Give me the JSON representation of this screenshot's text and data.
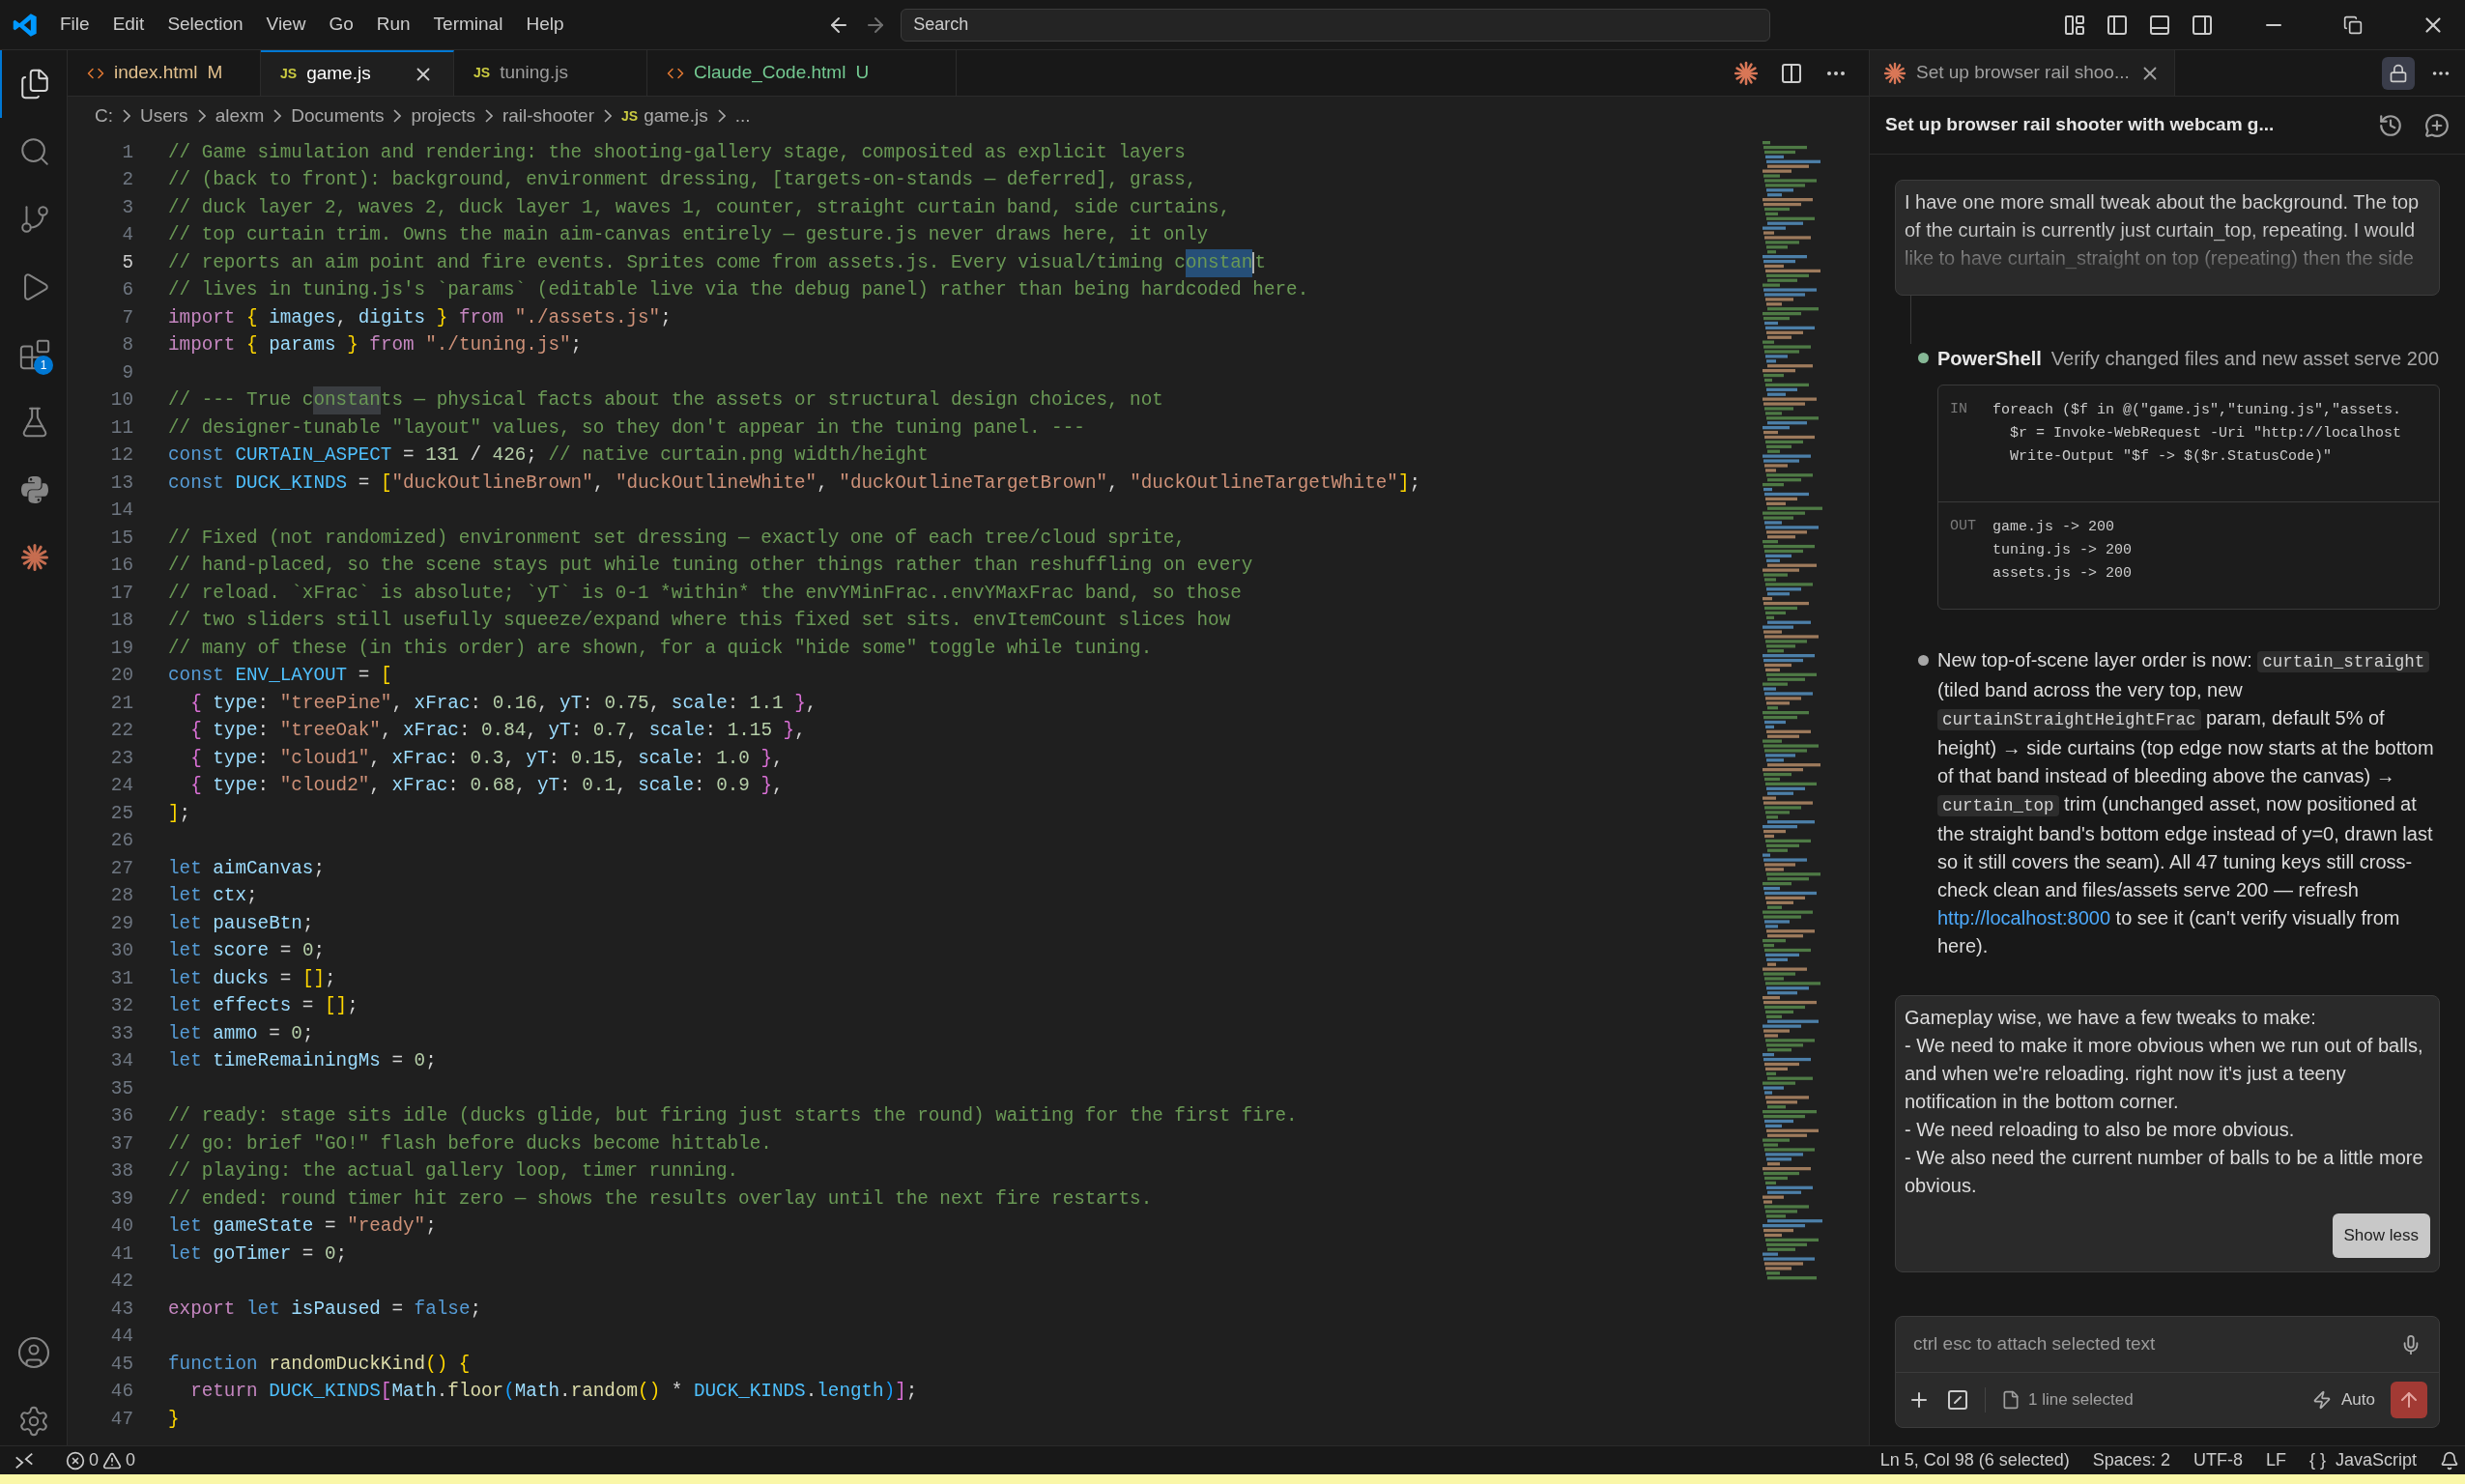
{
  "menu": [
    "File",
    "Edit",
    "Selection",
    "View",
    "Go",
    "Run",
    "Terminal",
    "Help"
  ],
  "search": {
    "placeholder": "Search"
  },
  "activity_bar": [
    {
      "kind": "files",
      "selected": true
    },
    {
      "kind": "search",
      "selected": false
    },
    {
      "kind": "branch",
      "selected": false
    },
    {
      "kind": "run",
      "selected": false
    },
    {
      "kind": "extensions",
      "selected": false,
      "badge": "1"
    },
    {
      "kind": "flask",
      "selected": false
    },
    {
      "kind": "python",
      "selected": false
    },
    {
      "kind": "starburst",
      "selected": false
    }
  ],
  "tabs": [
    {
      "label": "index.html",
      "kind": "html",
      "status": "M",
      "color": "#e2c08d",
      "selected": false
    },
    {
      "label": "game.js",
      "kind": "js",
      "badge": "JS",
      "selected": true
    },
    {
      "label": "tuning.js",
      "kind": "js",
      "badge": "JS",
      "selected": false
    },
    {
      "label": "Claude_Code.html",
      "kind": "html",
      "status": "U",
      "color": "#73c991",
      "selected": false
    }
  ],
  "breadcrumb": [
    {
      "label": "C:"
    },
    {
      "label": "Users"
    },
    {
      "label": "alexm"
    },
    {
      "label": "Documents"
    },
    {
      "label": "projects"
    },
    {
      "label": "rail-shooter"
    },
    {
      "label": "game.js",
      "badge": "JS"
    },
    {
      "label": "..."
    }
  ],
  "code_lines": [
    {
      "n": "1",
      "current": false,
      "tokens": [
        {
          "text": "// Game simulation and rendering: the shooting-gallery stage, composited as explicit layers",
          "kind": "comment"
        }
      ]
    },
    {
      "n": "2",
      "current": false,
      "tokens": [
        {
          "text": "// (back to front): background, environment dressing, [targets-on-stands — deferred], grass,",
          "kind": "comment"
        }
      ]
    },
    {
      "n": "3",
      "current": false,
      "tokens": [
        {
          "text": "// duck layer 2, waves 2, duck layer 1, waves 1, counter, straight curtain band, side curtains,",
          "kind": "comment"
        }
      ]
    },
    {
      "n": "4",
      "current": false,
      "tokens": [
        {
          "text": "// top curtain trim. Owns the main aim-canvas entirely — gesture.js never draws here, it only",
          "kind": "comment"
        }
      ]
    },
    {
      "n": "5",
      "current": true,
      "tokens": [
        {
          "text": "// reports an aim point and fire events. Sprites come from assets.js. Every visual/timing c",
          "kind": "comment"
        },
        {
          "text": "onstan",
          "kind": "selection"
        },
        {
          "text": "t",
          "kind": "comment"
        }
      ]
    },
    {
      "n": "6",
      "current": false,
      "tokens": [
        {
          "text": "// lives in tuning.js's `params` (editable live via the debug panel) rather than being hardcoded here.",
          "kind": "comment"
        }
      ]
    },
    {
      "n": "7",
      "current": false,
      "tokens": [
        {
          "text": "import ",
          "kind": "keyword"
        },
        {
          "text": "{",
          "kind": "bracket1"
        },
        {
          "text": " images",
          "kind": "variable"
        },
        {
          "text": ", ",
          "kind": "punct"
        },
        {
          "text": "digits ",
          "kind": "variable"
        },
        {
          "text": "}",
          "kind": "bracket1"
        },
        {
          "text": " from ",
          "kind": "keyword"
        },
        {
          "text": "\"./assets.js\"",
          "kind": "string"
        },
        {
          "text": ";",
          "kind": "punct"
        }
      ]
    },
    {
      "n": "8",
      "current": false,
      "tokens": [
        {
          "text": "import ",
          "kind": "keyword"
        },
        {
          "text": "{",
          "kind": "bracket1"
        },
        {
          "text": " params ",
          "kind": "variable"
        },
        {
          "text": "}",
          "kind": "bracket1"
        },
        {
          "text": " from ",
          "kind": "keyword"
        },
        {
          "text": "\"./tuning.js\"",
          "kind": "string"
        },
        {
          "text": ";",
          "kind": "punct"
        }
      ]
    },
    {
      "n": "9",
      "current": false
    },
    {
      "n": "10",
      "current": false,
      "tokens": [
        {
          "text": "// --- True c",
          "kind": "comment"
        },
        {
          "text": "onstan",
          "kind": "occurrence"
        },
        {
          "text": "ts — physical facts about the assets or structural design choices, not",
          "kind": "comment"
        }
      ]
    },
    {
      "n": "11",
      "current": false,
      "tokens": [
        {
          "text": "// designer-tunable \"layout\" values, so they don't appear in the tuning panel. ---",
          "kind": "comment"
        }
      ]
    },
    {
      "n": "12",
      "current": false,
      "tokens": [
        {
          "text": "const ",
          "kind": "storage"
        },
        {
          "text": "CURTAIN_ASPECT",
          "kind": "constant"
        },
        {
          "text": " = ",
          "kind": "punct"
        },
        {
          "text": "131",
          "kind": "number"
        },
        {
          "text": " / ",
          "kind": "punct"
        },
        {
          "text": "426",
          "kind": "number"
        },
        {
          "text": "; ",
          "kind": "punct"
        },
        {
          "text": "// native curtain.png width/height",
          "kind": "comment"
        }
      ]
    },
    {
      "n": "13",
      "current": false,
      "tokens": [
        {
          "text": "const ",
          "kind": "storage"
        },
        {
          "text": "DUCK_KINDS",
          "kind": "constant"
        },
        {
          "text": " = ",
          "kind": "punct"
        },
        {
          "text": "[",
          "kind": "bracket1"
        },
        {
          "text": "\"duckOutlineBrown\"",
          "kind": "string"
        },
        {
          "text": ", ",
          "kind": "punct"
        },
        {
          "text": "\"duckOutlineWhite\"",
          "kind": "string"
        },
        {
          "text": ", ",
          "kind": "punct"
        },
        {
          "text": "\"duckOutlineTargetBrown\"",
          "kind": "string"
        },
        {
          "text": ", ",
          "kind": "punct"
        },
        {
          "text": "\"duckOutlineTargetWhite\"",
          "kind": "string"
        },
        {
          "text": "]",
          "kind": "bracket1"
        },
        {
          "text": ";",
          "kind": "punct"
        }
      ]
    },
    {
      "n": "14",
      "current": false
    },
    {
      "n": "15",
      "current": false,
      "tokens": [
        {
          "text": "// Fixed (not randomized) environment set dressing — exactly one of each tree/cloud sprite,",
          "kind": "comment"
        }
      ]
    },
    {
      "n": "16",
      "current": false,
      "tokens": [
        {
          "text": "// hand-placed, so the scene stays put while tuning other things rather than reshuffling on every",
          "kind": "comment"
        }
      ]
    },
    {
      "n": "17",
      "current": false,
      "tokens": [
        {
          "text": "// reload. `xFrac` is absolute; `yT` is 0-1 *within* the envYMinFrac..envYMaxFrac band, so those",
          "kind": "comment"
        }
      ]
    },
    {
      "n": "18",
      "current": false,
      "tokens": [
        {
          "text": "// two sliders still usefully squeeze/expand where this fixed set sits. envItemCount slices how",
          "kind": "comment"
        }
      ]
    },
    {
      "n": "19",
      "current": false,
      "tokens": [
        {
          "text": "// many of these (in this order) are shown, for a quick \"hide some\" toggle while tuning.",
          "kind": "comment"
        }
      ]
    },
    {
      "n": "20",
      "current": false,
      "tokens": [
        {
          "text": "const ",
          "kind": "storage"
        },
        {
          "text": "ENV_LAYOUT",
          "kind": "constant"
        },
        {
          "text": " = ",
          "kind": "punct"
        },
        {
          "text": "[",
          "kind": "bracket1"
        }
      ]
    },
    {
      "n": "21",
      "current": false,
      "tokens": [
        {
          "text": "  {",
          "kind": "bracket2"
        },
        {
          "text": " type",
          "kind": "variable"
        },
        {
          "text": ": ",
          "kind": "punct"
        },
        {
          "text": "\"treePine\"",
          "kind": "string"
        },
        {
          "text": ", ",
          "kind": "punct"
        },
        {
          "text": "xFrac",
          "kind": "variable"
        },
        {
          "text": ": ",
          "kind": "punct"
        },
        {
          "text": "0.16",
          "kind": "number"
        },
        {
          "text": ", ",
          "kind": "punct"
        },
        {
          "text": "yT",
          "kind": "variable"
        },
        {
          "text": ": ",
          "kind": "punct"
        },
        {
          "text": "0.75",
          "kind": "number"
        },
        {
          "text": ", ",
          "kind": "punct"
        },
        {
          "text": "scale",
          "kind": "variable"
        },
        {
          "text": ": ",
          "kind": "punct"
        },
        {
          "text": "1.1",
          "kind": "number"
        },
        {
          "text": " }",
          "kind": "bracket2"
        },
        {
          "text": ",",
          "kind": "punct"
        }
      ]
    },
    {
      "n": "22",
      "current": false,
      "tokens": [
        {
          "text": "  {",
          "kind": "bracket2"
        },
        {
          "text": " type",
          "kind": "variable"
        },
        {
          "text": ": ",
          "kind": "punct"
        },
        {
          "text": "\"treeOak\"",
          "kind": "string"
        },
        {
          "text": ", ",
          "kind": "punct"
        },
        {
          "text": "xFrac",
          "kind": "variable"
        },
        {
          "text": ": ",
          "kind": "punct"
        },
        {
          "text": "0.84",
          "kind": "number"
        },
        {
          "text": ", ",
          "kind": "punct"
        },
        {
          "text": "yT",
          "kind": "variable"
        },
        {
          "text": ": ",
          "kind": "punct"
        },
        {
          "text": "0.7",
          "kind": "number"
        },
        {
          "text": ", ",
          "kind": "punct"
        },
        {
          "text": "scale",
          "kind": "variable"
        },
        {
          "text": ": ",
          "kind": "punct"
        },
        {
          "text": "1.15",
          "kind": "number"
        },
        {
          "text": " }",
          "kind": "bracket2"
        },
        {
          "text": ",",
          "kind": "punct"
        }
      ]
    },
    {
      "n": "23",
      "current": false,
      "tokens": [
        {
          "text": "  {",
          "kind": "bracket2"
        },
        {
          "text": " type",
          "kind": "variable"
        },
        {
          "text": ": ",
          "kind": "punct"
        },
        {
          "text": "\"cloud1\"",
          "kind": "string"
        },
        {
          "text": ", ",
          "kind": "punct"
        },
        {
          "text": "xFrac",
          "kind": "variable"
        },
        {
          "text": ": ",
          "kind": "punct"
        },
        {
          "text": "0.3",
          "kind": "number"
        },
        {
          "text": ", ",
          "kind": "punct"
        },
        {
          "text": "yT",
          "kind": "variable"
        },
        {
          "text": ": ",
          "kind": "punct"
        },
        {
          "text": "0.15",
          "kind": "number"
        },
        {
          "text": ", ",
          "kind": "punct"
        },
        {
          "text": "scale",
          "kind": "variable"
        },
        {
          "text": ": ",
          "kind": "punct"
        },
        {
          "text": "1.0",
          "kind": "number"
        },
        {
          "text": " }",
          "kind": "bracket2"
        },
        {
          "text": ",",
          "kind": "punct"
        }
      ]
    },
    {
      "n": "24",
      "current": false,
      "tokens": [
        {
          "text": "  {",
          "kind": "bracket2"
        },
        {
          "text": " type",
          "kind": "variable"
        },
        {
          "text": ": ",
          "kind": "punct"
        },
        {
          "text": "\"cloud2\"",
          "kind": "string"
        },
        {
          "text": ", ",
          "kind": "punct"
        },
        {
          "text": "xFrac",
          "kind": "variable"
        },
        {
          "text": ": ",
          "kind": "punct"
        },
        {
          "text": "0.68",
          "kind": "number"
        },
        {
          "text": ", ",
          "kind": "punct"
        },
        {
          "text": "yT",
          "kind": "variable"
        },
        {
          "text": ": ",
          "kind": "punct"
        },
        {
          "text": "0.1",
          "kind": "number"
        },
        {
          "text": ", ",
          "kind": "punct"
        },
        {
          "text": "scale",
          "kind": "variable"
        },
        {
          "text": ": ",
          "kind": "punct"
        },
        {
          "text": "0.9",
          "kind": "number"
        },
        {
          "text": " }",
          "kind": "bracket2"
        },
        {
          "text": ",",
          "kind": "punct"
        }
      ]
    },
    {
      "n": "25",
      "current": false,
      "tokens": [
        {
          "text": "]",
          "kind": "bracket1"
        },
        {
          "text": ";",
          "kind": "punct"
        }
      ]
    },
    {
      "n": "26",
      "current": false
    },
    {
      "n": "27",
      "current": false,
      "tokens": [
        {
          "text": "let ",
          "kind": "storage"
        },
        {
          "text": "aimCanvas",
          "kind": "variable"
        },
        {
          "text": ";",
          "kind": "punct"
        }
      ]
    },
    {
      "n": "28",
      "current": false,
      "tokens": [
        {
          "text": "let ",
          "kind": "storage"
        },
        {
          "text": "ctx",
          "kind": "variable"
        },
        {
          "text": ";",
          "kind": "punct"
        }
      ]
    },
    {
      "n": "29",
      "current": false,
      "tokens": [
        {
          "text": "let ",
          "kind": "storage"
        },
        {
          "text": "pauseBtn",
          "kind": "variable"
        },
        {
          "text": ";",
          "kind": "punct"
        }
      ]
    },
    {
      "n": "30",
      "current": false,
      "tokens": [
        {
          "text": "let ",
          "kind": "storage"
        },
        {
          "text": "score",
          "kind": "variable"
        },
        {
          "text": " = ",
          "kind": "punct"
        },
        {
          "text": "0",
          "kind": "number"
        },
        {
          "text": ";",
          "kind": "punct"
        }
      ]
    },
    {
      "n": "31",
      "current": false,
      "tokens": [
        {
          "text": "let ",
          "kind": "storage"
        },
        {
          "text": "ducks",
          "kind": "variable"
        },
        {
          "text": " = ",
          "kind": "punct"
        },
        {
          "text": "[]",
          "kind": "bracket1"
        },
        {
          "text": ";",
          "kind": "punct"
        }
      ]
    },
    {
      "n": "32",
      "current": false,
      "tokens": [
        {
          "text": "let ",
          "kind": "storage"
        },
        {
          "text": "effects",
          "kind": "variable"
        },
        {
          "text": " = ",
          "kind": "punct"
        },
        {
          "text": "[]",
          "kind": "bracket1"
        },
        {
          "text": ";",
          "kind": "punct"
        }
      ]
    },
    {
      "n": "33",
      "current": false,
      "tokens": [
        {
          "text": "let ",
          "kind": "storage"
        },
        {
          "text": "ammo",
          "kind": "variable"
        },
        {
          "text": " = ",
          "kind": "punct"
        },
        {
          "text": "0",
          "kind": "number"
        },
        {
          "text": ";",
          "kind": "punct"
        }
      ]
    },
    {
      "n": "34",
      "current": false,
      "tokens": [
        {
          "text": "let ",
          "kind": "storage"
        },
        {
          "text": "timeRemainingMs",
          "kind": "variable"
        },
        {
          "text": " = ",
          "kind": "punct"
        },
        {
          "text": "0",
          "kind": "number"
        },
        {
          "text": ";",
          "kind": "punct"
        }
      ]
    },
    {
      "n": "35",
      "current": false
    },
    {
      "n": "36",
      "current": false,
      "tokens": [
        {
          "text": "// ready: stage sits idle (ducks glide, but firing just starts the round) waiting for the first fire.",
          "kind": "comment"
        }
      ]
    },
    {
      "n": "37",
      "current": false,
      "tokens": [
        {
          "text": "// go: brief \"GO!\" flash before ducks become hittable.",
          "kind": "comment"
        }
      ]
    },
    {
      "n": "38",
      "current": false,
      "tokens": [
        {
          "text": "// playing: the actual gallery loop, timer running.",
          "kind": "comment"
        }
      ]
    },
    {
      "n": "39",
      "current": false,
      "tokens": [
        {
          "text": "// ended: round timer hit zero — shows the results overlay until the next fire restarts.",
          "kind": "comment"
        }
      ]
    },
    {
      "n": "40",
      "current": false,
      "tokens": [
        {
          "text": "let ",
          "kind": "storage"
        },
        {
          "text": "gameState",
          "kind": "variable"
        },
        {
          "text": " = ",
          "kind": "punct"
        },
        {
          "text": "\"ready\"",
          "kind": "string"
        },
        {
          "text": ";",
          "kind": "punct"
        }
      ]
    },
    {
      "n": "41",
      "current": false,
      "tokens": [
        {
          "text": "let ",
          "kind": "storage"
        },
        {
          "text": "goTimer",
          "kind": "variable"
        },
        {
          "text": " = ",
          "kind": "punct"
        },
        {
          "text": "0",
          "kind": "number"
        },
        {
          "text": ";",
          "kind": "punct"
        }
      ]
    },
    {
      "n": "42",
      "current": false
    },
    {
      "n": "43",
      "current": false,
      "tokens": [
        {
          "text": "export ",
          "kind": "keyword"
        },
        {
          "text": "let ",
          "kind": "storage"
        },
        {
          "text": "isPaused",
          "kind": "variable"
        },
        {
          "text": " = ",
          "kind": "punct"
        },
        {
          "text": "false",
          "kind": "storage"
        },
        {
          "text": ";",
          "kind": "punct"
        }
      ]
    },
    {
      "n": "44",
      "current": false
    },
    {
      "n": "45",
      "current": false,
      "tokens": [
        {
          "text": "function ",
          "kind": "storage"
        },
        {
          "text": "randomDuckKind",
          "kind": "function"
        },
        {
          "text": "()",
          "kind": "bracket1"
        },
        {
          "text": " {",
          "kind": "bracket1"
        }
      ]
    },
    {
      "n": "46",
      "current": false,
      "tokens": [
        {
          "text": "  return ",
          "kind": "keyword"
        },
        {
          "text": "DUCK_KINDS",
          "kind": "constant"
        },
        {
          "text": "[",
          "kind": "bracket2"
        },
        {
          "text": "Math",
          "kind": "variable"
        },
        {
          "text": ".",
          "kind": "punct"
        },
        {
          "text": "floor",
          "kind": "function"
        },
        {
          "text": "(",
          "kind": "bracket3"
        },
        {
          "text": "Math",
          "kind": "variable"
        },
        {
          "text": ".",
          "kind": "punct"
        },
        {
          "text": "random",
          "kind": "function"
        },
        {
          "text": "()",
          "kind": "bracket1"
        },
        {
          "text": " * ",
          "kind": "punct"
        },
        {
          "text": "DUCK_KINDS",
          "kind": "constant"
        },
        {
          "text": ".",
          "kind": "punct"
        },
        {
          "text": "length",
          "kind": "constant"
        },
        {
          "text": ")",
          "kind": "bracket3"
        },
        {
          "text": "]",
          "kind": "bracket2"
        },
        {
          "text": ";",
          "kind": "punct"
        }
      ]
    },
    {
      "n": "47",
      "current": false,
      "tokens": [
        {
          "text": "}",
          "kind": "bracket1"
        }
      ]
    }
  ],
  "chat": {
    "tab": {
      "label": "Set up browser rail shoo..."
    },
    "title": "Set up browser rail shooter with webcam g...",
    "first_message": "I have one more small tweak about the background. The top of the curtain is currently just curtain_top, repeating. I would like to have curtain_straight on top (repeating) then the side",
    "timeline": [
      {
        "kind": "tool",
        "color": "#86b896",
        "tool": "PowerShell",
        "description": "Verify changed files and new asset serve 200",
        "input": [
          "foreach ($f in @(\"game.js\",\"tuning.js\",\"assets.",
          "  $r = Invoke-WebRequest -Uri \"http://localhost",
          "  Write-Output \"$f -> $($r.StatusCode)\""
        ],
        "input_label": "IN",
        "output_label": "OUT",
        "output": [
          "game.js -> 200",
          "tuning.js -> 200",
          "assets.js -> 200"
        ]
      },
      {
        "kind": "message",
        "color": "#a6a6a6",
        "segments": [
          {
            "kind": "text",
            "text": "New top-of-scene layer order is now: "
          },
          {
            "kind": "code",
            "text": "curtain_straight"
          },
          {
            "kind": "text",
            "text": " (tiled band across the very top, new "
          },
          {
            "kind": "code",
            "text": "curtainStraightHeightFrac"
          },
          {
            "kind": "text",
            "text": " param, default 5% of height) → side curtains (top edge now starts at the bottom of that band instead of bleeding above the canvas) → "
          },
          {
            "kind": "code",
            "text": "curtain_top"
          },
          {
            "kind": "text",
            "text": " trim (unchanged asset, now positioned at the straight band's bottom edge instead of y=0, drawn last so it still covers the seam). All 47 tuning keys still cross-check clean and files/assets serve 200 — refresh "
          },
          {
            "kind": "link",
            "text": "http://localhost:8000"
          },
          {
            "kind": "text",
            "text": " to see it (can't verify visually from here)."
          }
        ]
      }
    ],
    "user_message": [
      "Gameplay wise, we have a few tweaks to make:",
      "- We need to make it more obvious when we run out of balls, and when we're reloading. right now it's just a teeny notification in the bottom corner.",
      "- We need reloading to also be more obvious.",
      "- We also need the current number of balls to be a little more obvious."
    ],
    "show_less": "Show less",
    "input": {
      "placeholder": "ctrl esc to attach selected text"
    },
    "context": "1 line selected",
    "mode": "Auto"
  },
  "status_bar": {
    "errors": "0",
    "warnings": "0",
    "position": "Ln 5, Col 98 (6 selected)",
    "indent": "Spaces: 2",
    "encoding": "UTF-8",
    "eol": "LF",
    "language_icon": "{ }",
    "language": "JavaScript"
  }
}
